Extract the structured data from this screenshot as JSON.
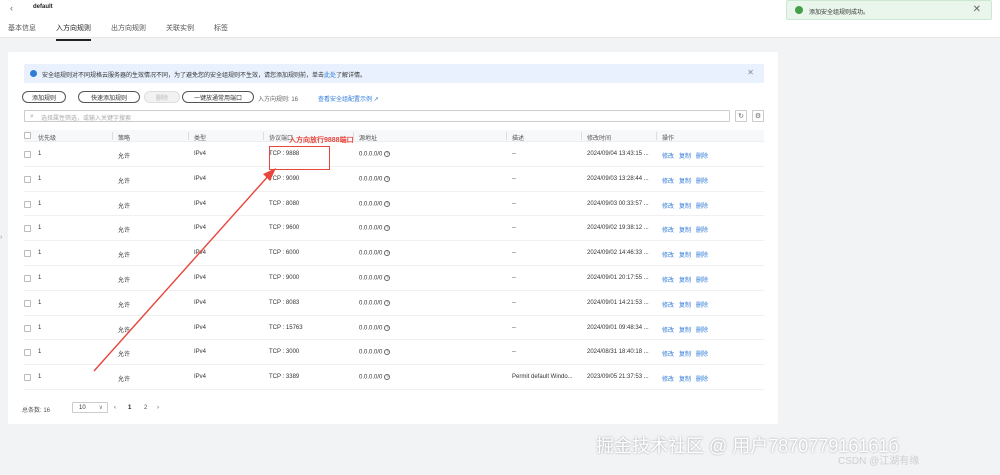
{
  "header": {
    "back_glyph": "‹",
    "title": "default",
    "tabs": [
      {
        "label": "基本信息"
      },
      {
        "label": "入方向规则",
        "active": true
      },
      {
        "label": "出方向规则"
      },
      {
        "label": "关联实例"
      },
      {
        "label": "标签"
      }
    ]
  },
  "toast": {
    "text": "添加安全组规则成功。",
    "close": "✕",
    "color": "#43a047"
  },
  "notice": {
    "text": "安全组规则对不同规格云服务器的生效情况不同，为了避免您的安全组规则不生效，请您添加规则前，单击",
    "link": "此处",
    "suffix": "了解详情。",
    "close": "✕"
  },
  "toolbar": {
    "add_rule": "添加规则",
    "quick_add": "快速添加规则",
    "delete": "删除",
    "open_common_ports": "一键放通常用端口",
    "rule_count_label": "入方向规则:",
    "rule_count": "16",
    "example_link": "查看安全组配置示例",
    "link_icon": "↗"
  },
  "search": {
    "placeholder": "选择属性筛选，或输入关键字搜索",
    "search_icon": "⌕",
    "refresh_icon": "↻",
    "settings_icon": "⚙"
  },
  "table": {
    "headers": [
      "优先级",
      "策略",
      "类型",
      "协议端口",
      "源地址",
      "描述",
      "修改时间",
      "操作"
    ],
    "rows": [
      {
        "priority": "1",
        "action": "允许",
        "type": "IPv4",
        "port": "TCP : 9888",
        "source": "0.0.0.0/0",
        "desc": "--",
        "time": "2024/09/04 13:43:15 ..."
      },
      {
        "priority": "1",
        "action": "允许",
        "type": "IPv4",
        "port": "TCP : 9090",
        "source": "0.0.0.0/0",
        "desc": "--",
        "time": "2024/09/03 13:28:44 ..."
      },
      {
        "priority": "1",
        "action": "允许",
        "type": "IPv4",
        "port": "TCP : 8080",
        "source": "0.0.0.0/0",
        "desc": "--",
        "time": "2024/09/03 00:33:57 ..."
      },
      {
        "priority": "1",
        "action": "允许",
        "type": "IPv4",
        "port": "TCP : 9600",
        "source": "0.0.0.0/0",
        "desc": "--",
        "time": "2024/09/02 19:38:12 ..."
      },
      {
        "priority": "1",
        "action": "允许",
        "type": "IPv4",
        "port": "TCP : 6000",
        "source": "0.0.0.0/0",
        "desc": "--",
        "time": "2024/09/02 14:46:33 ..."
      },
      {
        "priority": "1",
        "action": "允许",
        "type": "IPv4",
        "port": "TCP : 9000",
        "source": "0.0.0.0/0",
        "desc": "--",
        "time": "2024/09/01 20:17:55 ..."
      },
      {
        "priority": "1",
        "action": "允许",
        "type": "IPv4",
        "port": "TCP : 8083",
        "source": "0.0.0.0/0",
        "desc": "--",
        "time": "2024/09/01 14:21:53 ..."
      },
      {
        "priority": "1",
        "action": "允许",
        "type": "IPv4",
        "port": "TCP : 15763",
        "source": "0.0.0.0/0",
        "desc": "--",
        "time": "2024/09/01 09:48:34 ..."
      },
      {
        "priority": "1",
        "action": "允许",
        "type": "IPv4",
        "port": "TCP : 3000",
        "source": "0.0.0.0/0",
        "desc": "--",
        "time": "2024/08/31 18:40:18 ..."
      },
      {
        "priority": "1",
        "action": "允许",
        "type": "IPv4",
        "port": "TCP : 3389",
        "source": "0.0.0.0/0",
        "desc": "Permit default Windo...",
        "time": "2023/09/05 21:37:53 ..."
      }
    ],
    "ops": [
      "修改",
      "复制",
      "删除"
    ],
    "help_glyph": "?"
  },
  "pagination": {
    "total": "总条数: 16",
    "page_size": "10",
    "dropdown_glyph": "∨",
    "prev": "‹",
    "pages": [
      "1",
      "2"
    ],
    "next": "›"
  },
  "annotation": {
    "text": "入方向放行9888端口",
    "color": "#e8453c"
  },
  "side_handle": "›",
  "watermark": {
    "main": "掘金技术社区 @ 用户787077916161б",
    "sub": "CSDN @江湖有缘"
  }
}
